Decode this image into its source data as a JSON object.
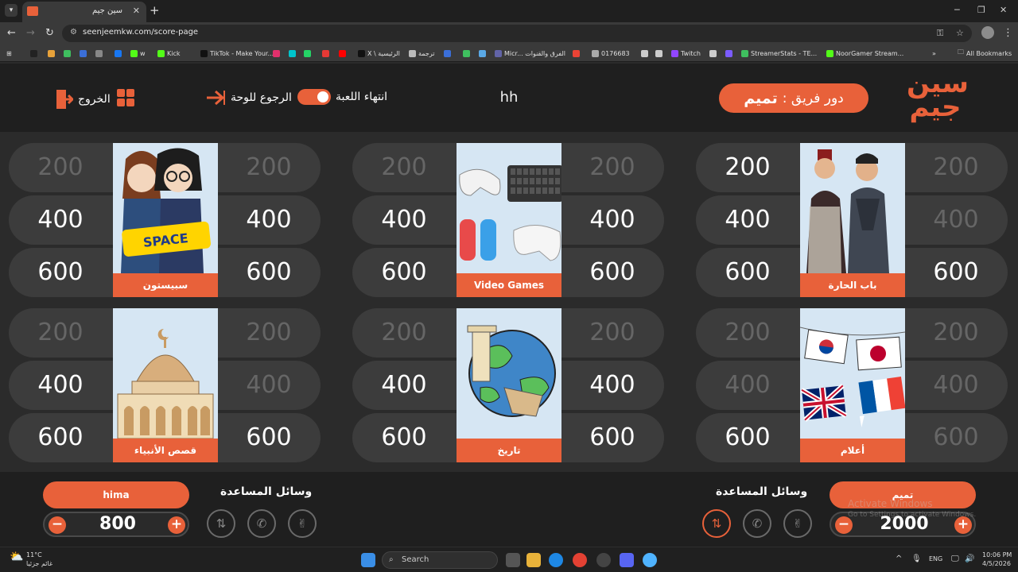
{
  "browser": {
    "tab_title": "سين جيم",
    "new_tab": "+",
    "url": "seenjeemkw.com/score-page",
    "bookmarks": [
      {
        "label": "",
        "color": "#222"
      },
      {
        "label": "",
        "color": "#e8a23a"
      },
      {
        "label": "",
        "color": "#3fbf5f"
      },
      {
        "label": "",
        "color": "#3b6fd8"
      },
      {
        "label": "",
        "color": "#888"
      },
      {
        "label": "",
        "color": "#1877f2"
      },
      {
        "label": "w",
        "color": "#53fc18"
      },
      {
        "label": "Kick",
        "color": "#53fc18"
      },
      {
        "label": "TikTok - Make Your...",
        "color": "#111"
      },
      {
        "label": "",
        "color": "#e1306c"
      },
      {
        "label": "",
        "color": "#00c4cc"
      },
      {
        "label": "",
        "color": "#25d366"
      },
      {
        "label": "",
        "color": "#e53935"
      },
      {
        "label": "",
        "color": "#ff0000"
      },
      {
        "label": "X \\ الرئيسية",
        "color": "#111"
      },
      {
        "label": "ترجمة",
        "color": "#bbb"
      },
      {
        "label": "",
        "color": "#3b6fd8"
      },
      {
        "label": "",
        "color": "#3fbf5f"
      },
      {
        "label": "",
        "color": "#5aa9e6"
      },
      {
        "label": "Micr... الفرق والقنوات",
        "color": "#6264a7"
      },
      {
        "label": "",
        "color": "#ea4335"
      },
      {
        "label": "0176683",
        "color": "#aaa"
      },
      {
        "label": "",
        "color": "#ccc"
      },
      {
        "label": "",
        "color": "#ccc"
      },
      {
        "label": "Twitch",
        "color": "#9146ff"
      },
      {
        "label": "",
        "color": "#ccc"
      },
      {
        "label": "",
        "color": "#7b5cff"
      },
      {
        "label": "StreamerStats - TE...",
        "color": "#3fbf5f"
      },
      {
        "label": "NoorGamer Stream...",
        "color": "#53fc18"
      }
    ],
    "all_bookmarks": "All Bookmarks"
  },
  "header": {
    "logo_line1": "سين",
    "logo_line2": "جيم",
    "turn_label": "دور فريق :",
    "turn_team": "تميم",
    "game_name": "hh",
    "end_game": "انتهاء اللعبة",
    "back_to_board": "الرجوع للوحة",
    "exit": "الخروج"
  },
  "board": {
    "categories": [
      {
        "name": "باب الحارة",
        "left_values": [
          "200",
          "400",
          "600"
        ],
        "right_values": [
          "200",
          "400",
          "600"
        ],
        "left_used": [
          false,
          false,
          false
        ],
        "right_used": [
          true,
          true,
          false
        ]
      },
      {
        "name": "Video Games",
        "left_values": [
          "200",
          "400",
          "600"
        ],
        "right_values": [
          "200",
          "400",
          "600"
        ],
        "left_used": [
          true,
          false,
          false
        ],
        "right_used": [
          true,
          false,
          false
        ]
      },
      {
        "name": "سبيستون",
        "left_values": [
          "200",
          "400",
          "600"
        ],
        "right_values": [
          "200",
          "400",
          "600"
        ],
        "left_used": [
          true,
          false,
          false
        ],
        "right_used": [
          true,
          false,
          false
        ]
      },
      {
        "name": "أعلام",
        "left_values": [
          "200",
          "400",
          "600"
        ],
        "right_values": [
          "200",
          "400",
          "600"
        ],
        "left_used": [
          true,
          true,
          false
        ],
        "right_used": [
          true,
          true,
          true
        ]
      },
      {
        "name": "تاريخ",
        "left_values": [
          "200",
          "400",
          "600"
        ],
        "right_values": [
          "200",
          "400",
          "600"
        ],
        "left_used": [
          true,
          false,
          false
        ],
        "right_used": [
          true,
          false,
          false
        ]
      },
      {
        "name": "قصص الأنبياء",
        "left_values": [
          "200",
          "400",
          "600"
        ],
        "right_values": [
          "200",
          "400",
          "600"
        ],
        "left_used": [
          true,
          false,
          false
        ],
        "right_used": [
          true,
          true,
          false
        ]
      }
    ]
  },
  "teams": {
    "right": {
      "name": "تميم",
      "score": "2000",
      "helps_title": "وسائل المساعدة",
      "minus": "−",
      "plus": "+"
    },
    "left": {
      "name": "hima",
      "score": "800",
      "helps_title": "وسائل المساعدة",
      "minus": "−",
      "plus": "+"
    }
  },
  "windows_watermark": {
    "line1": "Activate Windows",
    "line2": "Go to Settings to activate Windows."
  },
  "taskbar": {
    "weather_temp": "11°C",
    "weather_desc": "غائم جزئيا",
    "search": "Search",
    "lang": "ENG",
    "time": "10:06 PM",
    "date": "4/5/2026"
  },
  "colors": {
    "accent": "#e8613a",
    "background": "#2b2b2b",
    "pill": "#3c3c3c",
    "used_value": "#666666"
  }
}
